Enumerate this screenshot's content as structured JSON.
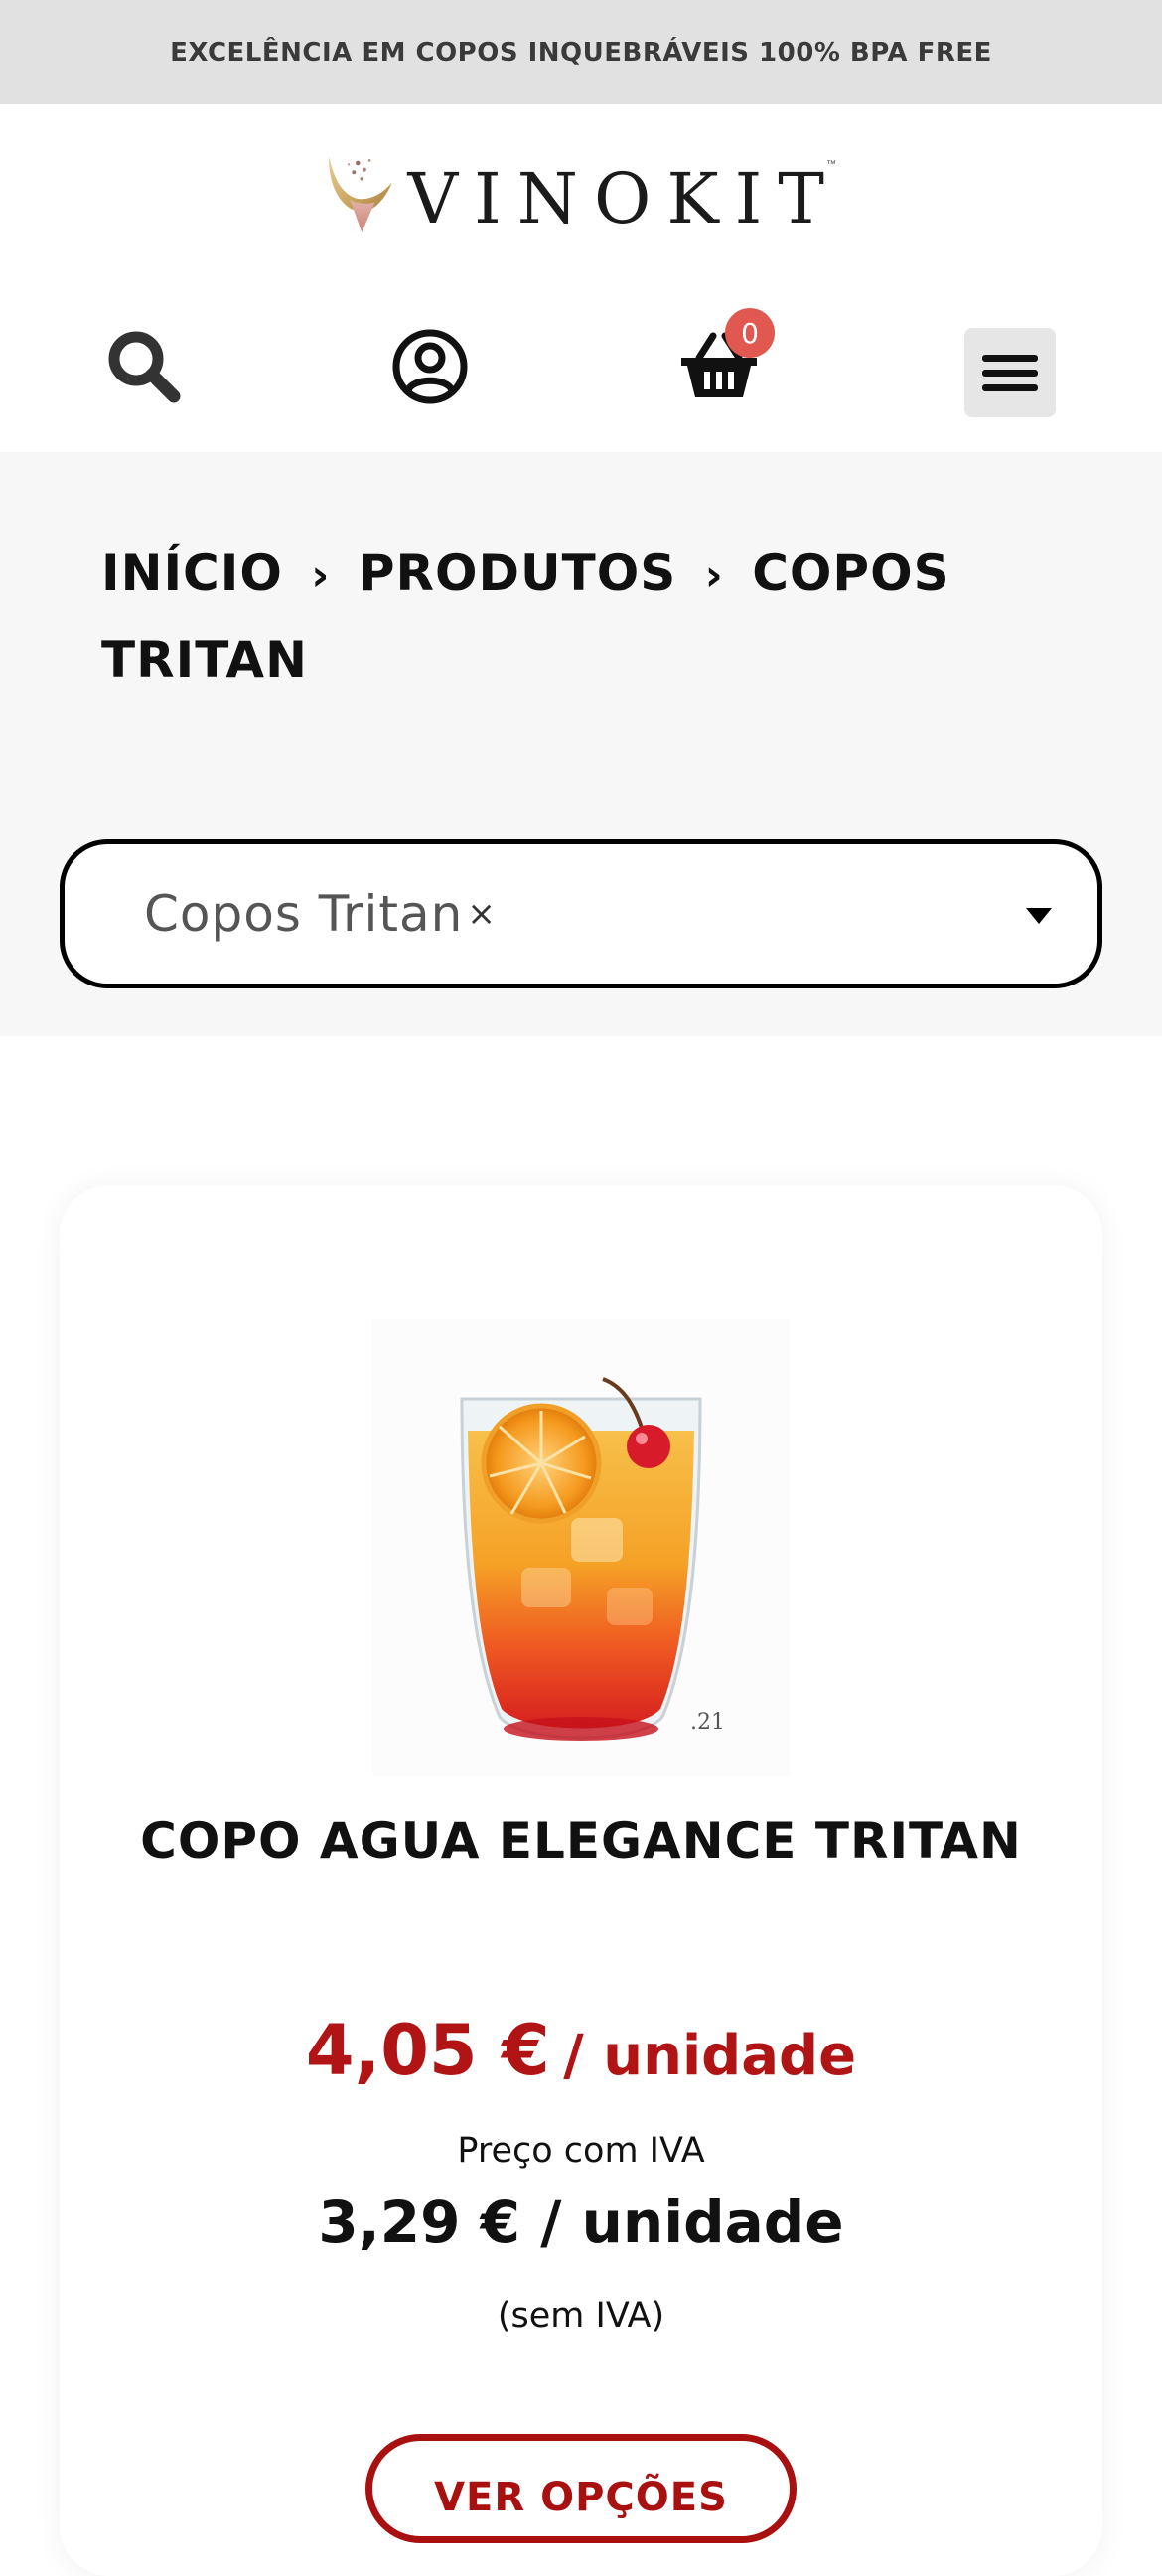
{
  "promo_bar": {
    "text": "EXCELÊNCIA EM COPOS INQUEBRÁVEIS 100% BPA FREE"
  },
  "header": {
    "logo_text": "VINOKIT",
    "logo_mark": "™",
    "icons": {
      "search": "search-icon",
      "account": "user-circle-icon",
      "cart": "shopping-basket-icon",
      "menu": "hamburger-menu-icon"
    },
    "cart_count": "0"
  },
  "breadcrumb": {
    "items": [
      "INÍCIO",
      "PRODUTOS",
      "COPOS TRITAN"
    ],
    "separator": "›"
  },
  "filter": {
    "selected_value": "Copos Tritan",
    "clear_symbol": "×"
  },
  "product": {
    "image_label": ".21",
    "title": "COPO AGUA ELEGANCE TRITAN",
    "price_with_vat": "4,05 €",
    "price_with_vat_unit": "/ unidade",
    "price_with_vat_label": "Preço com IVA",
    "price_without_vat": "3,29 € / unidade",
    "price_without_vat_label": "(sem IVA)",
    "options_button": "VER OPÇÕES"
  },
  "colors": {
    "promo_bg": "#e2e1e1",
    "section_bg": "#f7f7f7",
    "price_red": "#b11414",
    "badge_red": "#e0584f",
    "button_red": "#a91010"
  }
}
